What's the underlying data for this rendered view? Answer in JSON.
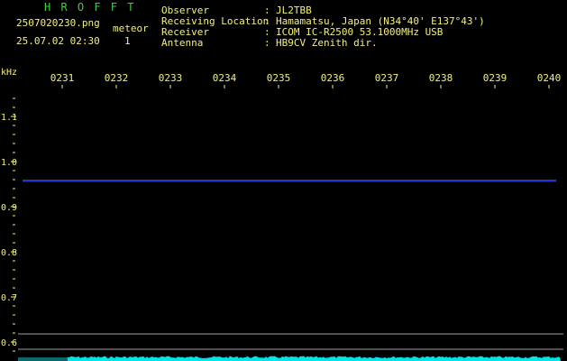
{
  "header": {
    "app_title": "H R O F F T",
    "filename": "2507020230.png",
    "datetime": "25.07.02 02:30",
    "meteor_label": "meteor",
    "meteor_count": "1",
    "info": [
      {
        "label": "Observer",
        "value": "JL2TBB"
      },
      {
        "label": "Receiving Location",
        "value": "Hamamatsu, Japan (N34°40' E137°43')"
      },
      {
        "label": "Receiver",
        "value": "ICOM IC-R2500 53.1000MHz USB"
      },
      {
        "label": "Antenna",
        "value": "HB9CV Zenith dir."
      }
    ]
  },
  "colors": {
    "background": "#000000",
    "text_green": "#3fd03f",
    "text_yellow": "#f5f07a",
    "text_white": "#e8e8e8",
    "signal_trace": "#2b4cff",
    "noise_band": "#00e5e5",
    "axis_line": "#a0a0a0"
  },
  "chart_data": {
    "type": "line",
    "ylabel": "kHz",
    "x_ticks": [
      "0231",
      "0232",
      "0233",
      "0234",
      "0235",
      "0236",
      "0237",
      "0238",
      "0239",
      "0240"
    ],
    "y_ticks": [
      "1.1",
      "1.0",
      "0.9",
      "0.8",
      "0.7",
      "0.6"
    ],
    "ylim": [
      0.58,
      1.15
    ],
    "series": [
      {
        "x_start": "0230",
        "x_end": "0240",
        "frequency_khz": 0.958
      }
    ],
    "grid": false
  }
}
